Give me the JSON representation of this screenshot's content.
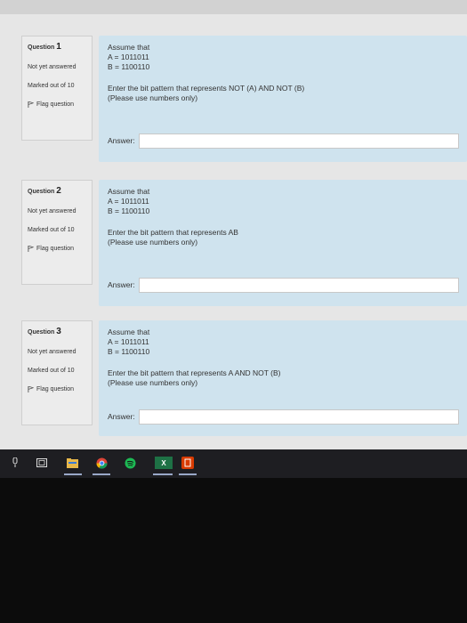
{
  "questions": [
    {
      "label": "Question",
      "number": "1",
      "status": "Not yet answered",
      "marks": "Marked out of 10",
      "flag": "Flag question",
      "intro": "Assume that",
      "a": "A = 1011011",
      "b": "B = 1100110",
      "prompt": "Enter the bit pattern that represents NOT (A) AND NOT (B)",
      "note": "(Please use numbers only)",
      "answer_label": "Answer:",
      "answer_value": ""
    },
    {
      "label": "Question",
      "number": "2",
      "status": "Not yet answered",
      "marks": "Marked out of 10",
      "flag": "Flag question",
      "intro": "Assume that",
      "a": "A = 1011011",
      "b": "B = 1100110",
      "prompt": "Enter the bit pattern that represents AB",
      "note": "(Please use numbers only)",
      "answer_label": "Answer:",
      "answer_value": ""
    },
    {
      "label": "Question",
      "number": "3",
      "status": "Not yet answered",
      "marks": "Marked out of 10",
      "flag": "Flag question",
      "intro": "Assume that",
      "a": "A = 1011011",
      "b": "B = 1100110",
      "prompt": "Enter the bit pattern that represents A AND NOT (B)",
      "note": "(Please use numbers only)",
      "answer_label": "Answer:",
      "answer_value": ""
    }
  ],
  "taskbar": {
    "items": [
      "task-view-icon",
      "file-explorer-icon",
      "chrome-icon",
      "spotify-icon",
      "excel-icon",
      "office-icon"
    ],
    "excel_label": "X"
  },
  "colors": {
    "content_bg": "#cfe3ee",
    "info_bg": "#ececec",
    "taskbar_bg": "#1e1e22"
  }
}
